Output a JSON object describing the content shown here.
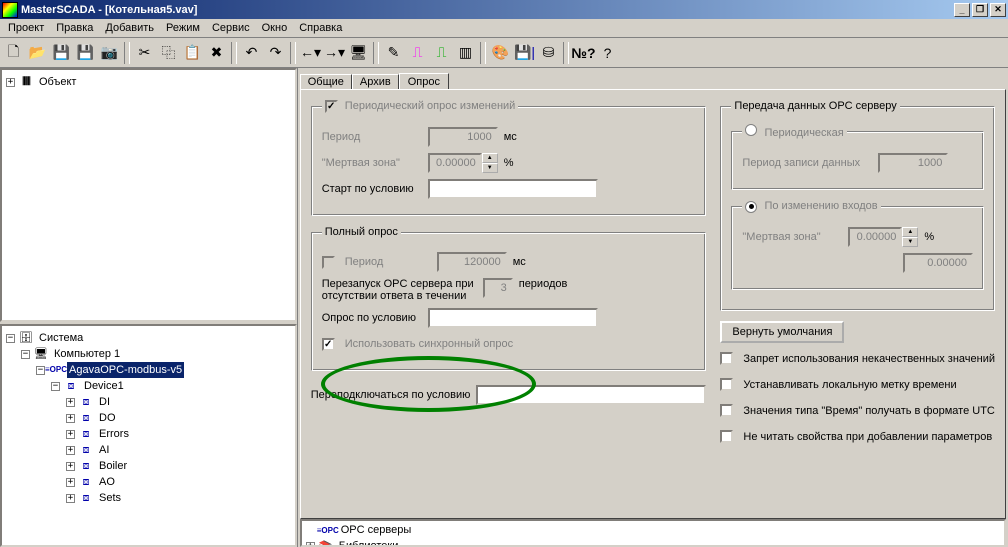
{
  "title": "MasterSCADA - [Котельная5.vav]",
  "menu": [
    "Проект",
    "Правка",
    "Добавить",
    "Режим",
    "Сервис",
    "Окно",
    "Справка"
  ],
  "tree_top_root": "Объект",
  "tree_bot": {
    "root": "Система",
    "computer": "Компьютер 1",
    "opc": "AgavaOPC-modbus-v5",
    "device": "Device1",
    "items": [
      "DI",
      "DO",
      "Errors",
      "AI",
      "Boiler",
      "AO",
      "Sets"
    ]
  },
  "tabs": [
    "Общие",
    "Архив",
    "Опрос"
  ],
  "active_tab": 2,
  "periodic_group": {
    "legend": "Периодический опрос изменений",
    "period_label": "Период",
    "period_value": "1000",
    "period_unit": "мс",
    "dead_label": "\"Мертвая зона\"",
    "dead_value": "0.00000",
    "dead_unit": "%",
    "start_cond_label": "Старт по условию",
    "start_cond_value": ""
  },
  "full_group": {
    "legend": "Полный опрос",
    "period_label": "Период",
    "period_value": "120000",
    "period_unit": "мс",
    "restart_label1": "Перезапуск OPC сервера при",
    "restart_label2": "отсутствии ответа в течении",
    "restart_value": "3",
    "restart_unit": "периодов",
    "cond_label": "Опрос по условию",
    "cond_value": "",
    "sync_label": "Использовать синхронный опрос"
  },
  "reconnect_label": "Переподключаться по условию",
  "reconnect_value": "",
  "send_group": {
    "legend": "Передача данных OPC серверу",
    "periodic_label": "Периодическая",
    "write_period_label": "Период записи данных",
    "write_period_value": "1000",
    "onchange_label": "По изменению входов",
    "dead_label": "\"Мертвая зона\"",
    "dead_value": "0.00000",
    "dead_unit": "%",
    "extra_value": "0.00000"
  },
  "defaults_btn": "Вернуть умолчания",
  "opts": [
    "Запрет использования некачественных значений",
    "Устанавливать локальную метку времени",
    "Значения типа \"Время\" получать в формате UTC",
    "Не читать свойства при добавлении параметров"
  ],
  "bottom_lib": [
    "OPC серверы",
    "Библиотеки"
  ]
}
